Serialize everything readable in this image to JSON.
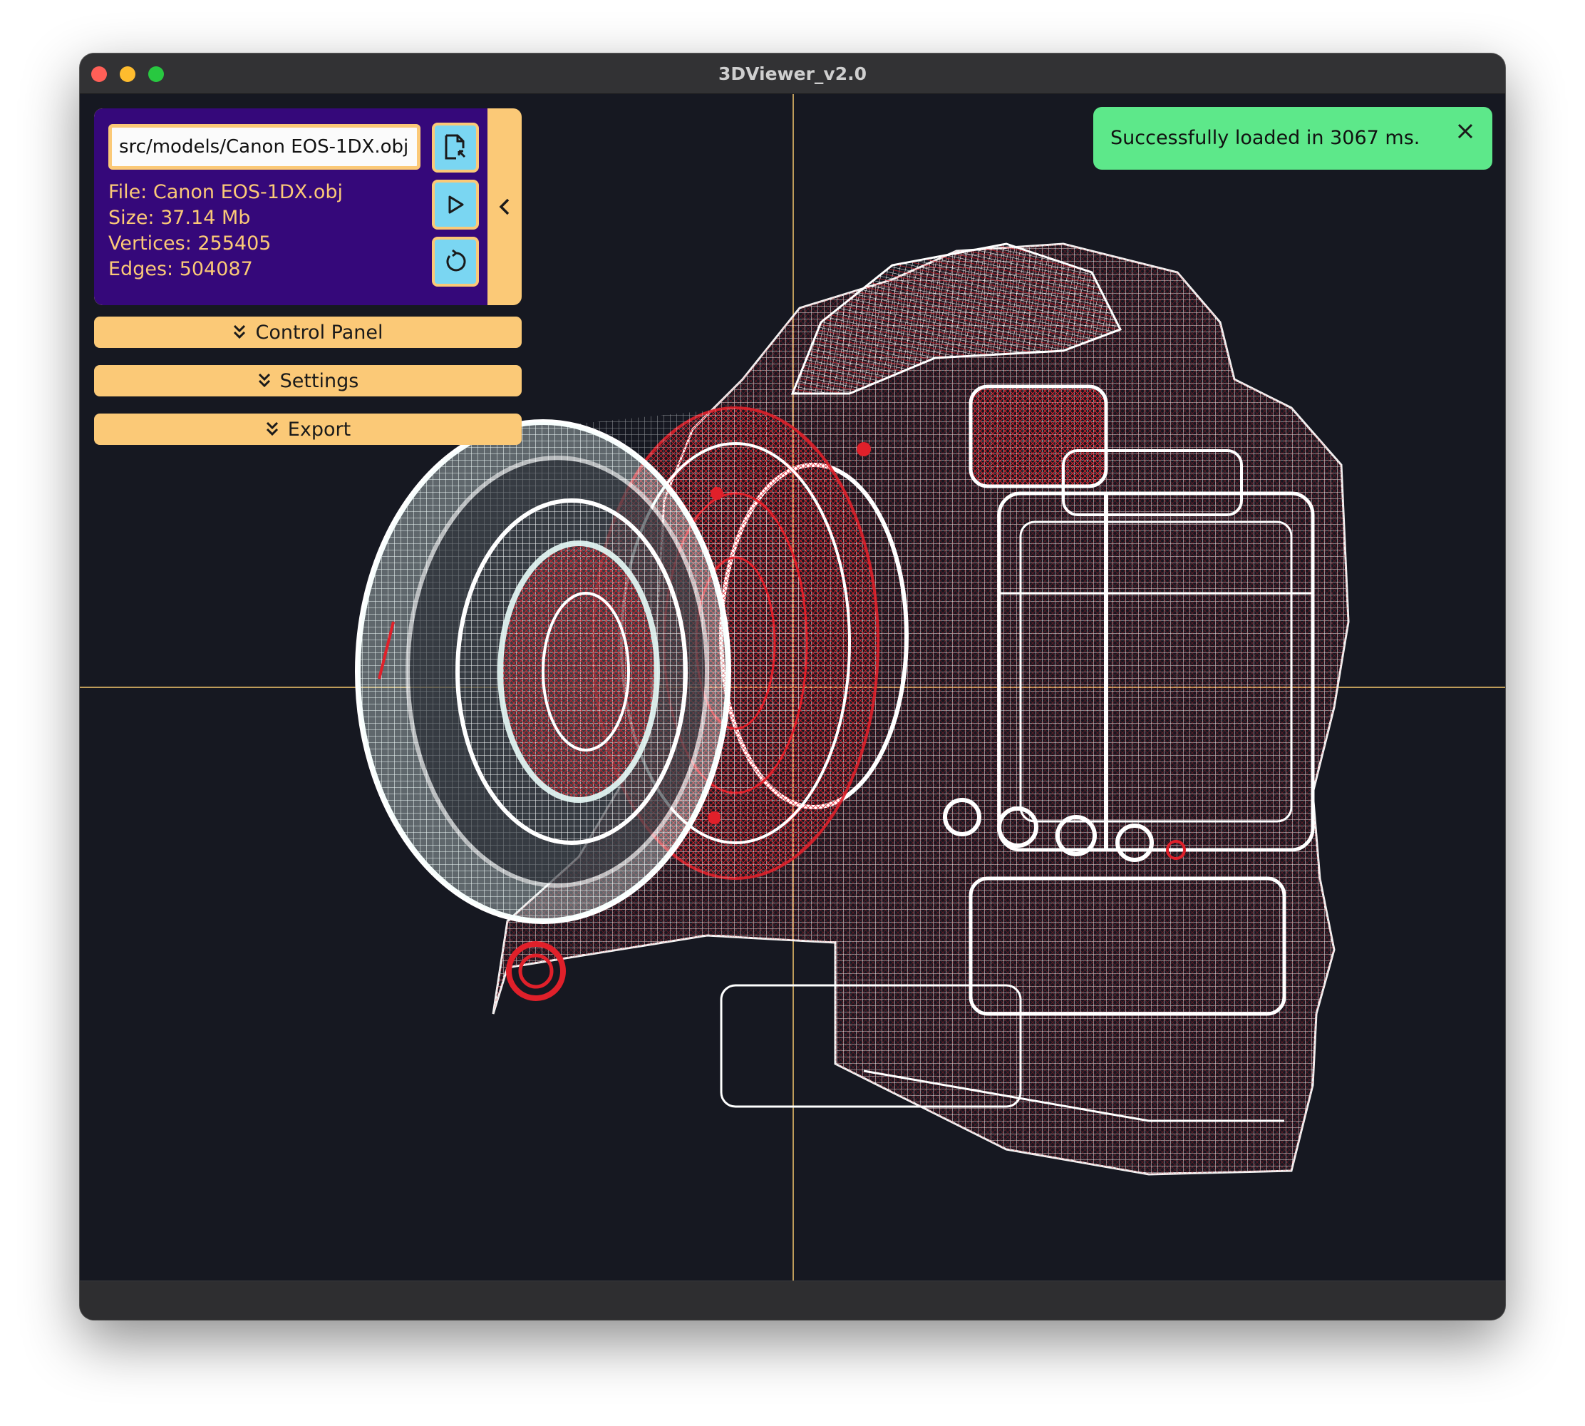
{
  "window": {
    "title": "3DViewer_v2.0"
  },
  "file_panel": {
    "path_value": "src/models/Canon EOS-1DX.obj",
    "file_line": "File: Canon EOS-1DX.obj",
    "size_line": "Size: 37.14 Mb",
    "vertices_line": "Vertices: 255405",
    "edges_line": "Edges: 504087",
    "icons": [
      "open-file-icon",
      "play-icon",
      "reset-icon",
      "chevron-left-icon"
    ]
  },
  "panels": {
    "control_panel": "Control Panel",
    "settings": "Settings",
    "export": "Export"
  },
  "toast": {
    "message": "Successfully loaded in 3067 ms."
  },
  "colors": {
    "accent": "#fbc977",
    "panel_bg": "#35087a",
    "button_blue": "#7ad6f2",
    "toast_green": "#5de88a",
    "viewport_bg": "#161821",
    "wire_white": "#ffffff",
    "wire_red": "#e0202a",
    "crosshair": "#f5c86e"
  }
}
